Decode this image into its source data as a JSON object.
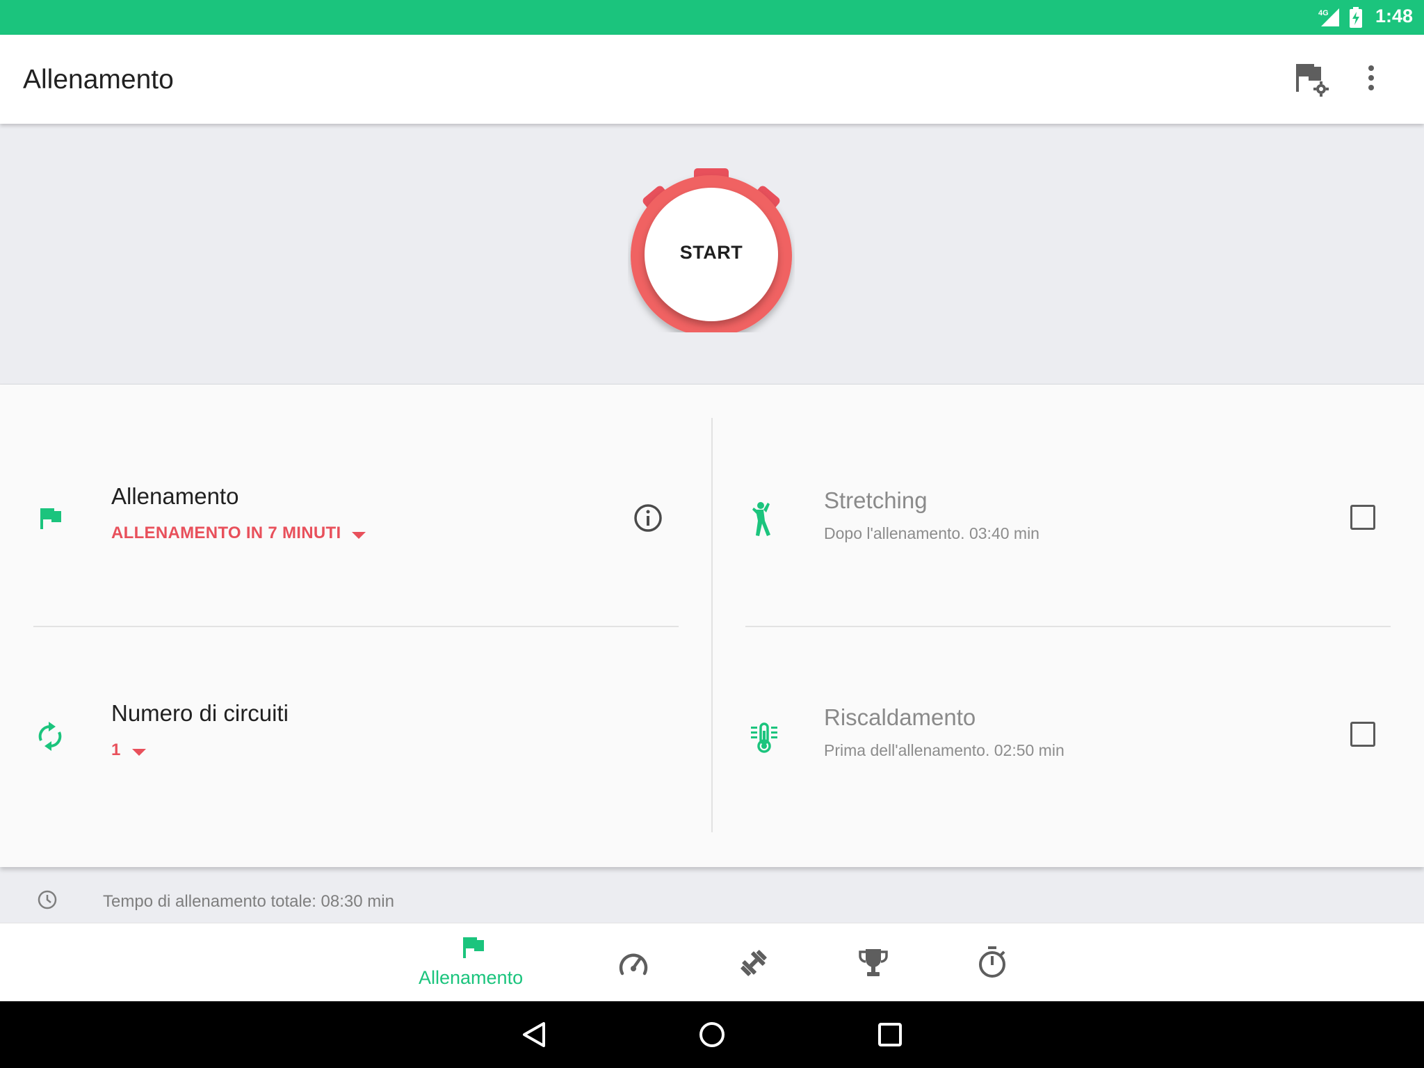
{
  "status_bar": {
    "time": "1:48",
    "network": "4G"
  },
  "app_bar": {
    "title": "Allenamento"
  },
  "hero": {
    "start_label": "START"
  },
  "settings": {
    "workout": {
      "title": "Allenamento",
      "value": "ALLENAMENTO IN 7 MINUTI"
    },
    "circuits": {
      "title": "Numero di circuiti",
      "value": "1"
    },
    "stretching": {
      "title": "Stretching",
      "subtitle": "Dopo l'allenamento. 03:40 min",
      "checked": false
    },
    "warmup": {
      "title": "Riscaldamento",
      "subtitle": "Prima dell'allenamento. 02:50 min",
      "checked": false
    }
  },
  "total": {
    "text": "Tempo di allenamento totale: 08:30 min"
  },
  "bottom_nav": {
    "items": [
      {
        "label": "Allenamento",
        "icon": "flag-icon",
        "active": true
      },
      {
        "label": "",
        "icon": "speedometer-icon",
        "active": false
      },
      {
        "label": "",
        "icon": "dumbbell-icon",
        "active": false
      },
      {
        "label": "",
        "icon": "trophy-icon",
        "active": false
      },
      {
        "label": "",
        "icon": "stopwatch-icon",
        "active": false
      }
    ]
  },
  "colors": {
    "accent_green": "#1BC47D",
    "accent_red": "#E8505B",
    "background": "#ECEDF1"
  }
}
